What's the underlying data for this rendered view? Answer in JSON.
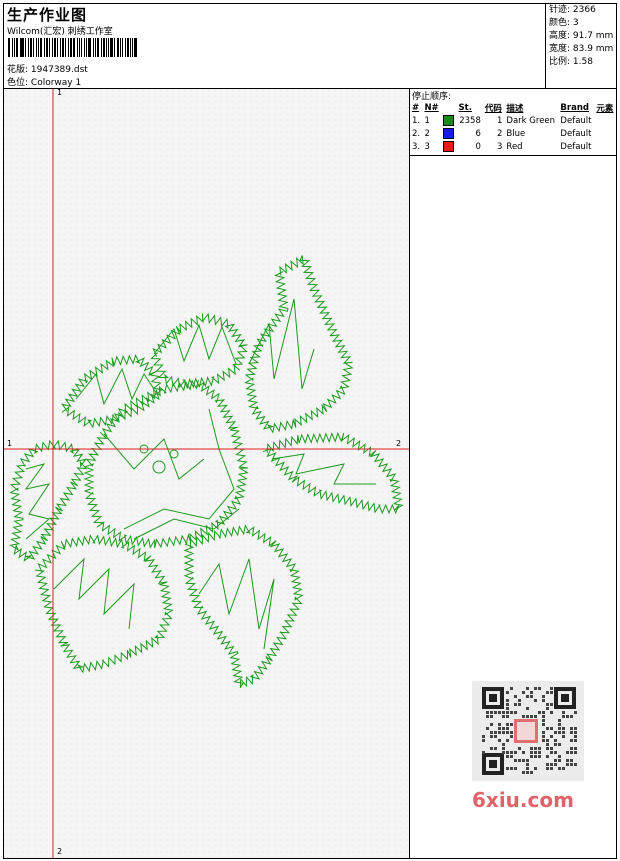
{
  "header": {
    "title": "生产作业图",
    "subtitle": "Wilcom(汇宏) 刺绣工作室",
    "design_label": "花版:",
    "design_value": "1947389.dst",
    "colorway_label": "色位:",
    "colorway_value": "Colorway 1"
  },
  "stats": {
    "stitches": "针迹: 2366",
    "colors": "颜色: 3",
    "height": "高度: 91.7 mm",
    "width": "宽度: 83.9 mm",
    "scale": "比例: 1.58"
  },
  "canvas": {
    "background": "#f6f5f6",
    "crosshair_color": "#e02020",
    "stitch_color": "#1a9a1a",
    "marks": {
      "top": "1",
      "left": "1",
      "right": "2",
      "bottom": "2"
    }
  },
  "stop_sequence": {
    "title": "停止顺序:",
    "columns": [
      "#",
      "N#",
      "St.",
      "代码",
      "描述",
      "Brand",
      "元素"
    ],
    "rows": [
      {
        "idx": "1.",
        "n": "1",
        "color": "#1a8a1a",
        "st": "2358",
        "code": "1",
        "desc": "Dark Green",
        "brand": "Default"
      },
      {
        "idx": "2.",
        "n": "2",
        "color": "#1a1aee",
        "st": "6",
        "code": "2",
        "desc": "Blue",
        "brand": "Default"
      },
      {
        "idx": "3.",
        "n": "3",
        "color": "#ee1a1a",
        "st": "0",
        "code": "3",
        "desc": "Red",
        "brand": "Default"
      }
    ]
  },
  "watermark": {
    "text": "6xiu.com"
  }
}
